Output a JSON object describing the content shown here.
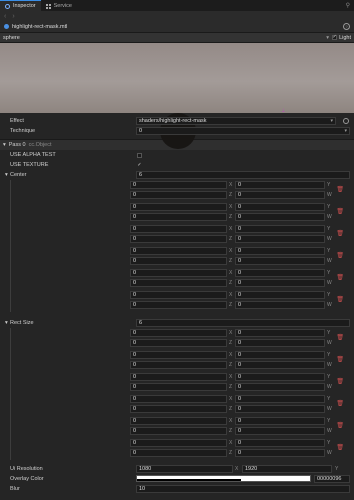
{
  "tabs": [
    {
      "label": "Inspector",
      "icon": "inspector-icon",
      "active": true
    },
    {
      "label": "Service",
      "icon": "grid-icon",
      "active": false
    }
  ],
  "nav": {
    "back": "‹",
    "forward": "›"
  },
  "file": {
    "name": "highlight-rect-mask.mtl"
  },
  "preview": {
    "mesh": "sphere",
    "light_label": "Light",
    "light_checked": true
  },
  "effect": {
    "label": "Effect",
    "value": "shaders/highlight-rect-mask"
  },
  "technique": {
    "label": "Technique",
    "value": "0"
  },
  "pass": {
    "title": "Pass 0",
    "tag": "cc.Object"
  },
  "use_alpha_test": {
    "label": "USE ALPHA TEST",
    "checked": false
  },
  "use_texture": {
    "label": "USE TEXTURE",
    "checked": true
  },
  "center": {
    "label": "Center",
    "count": "6",
    "items": [
      {
        "x": "0",
        "y": "0",
        "z": "0",
        "w": "0"
      },
      {
        "x": "0",
        "y": "0",
        "z": "0",
        "w": "0"
      },
      {
        "x": "0",
        "y": "0",
        "z": "0",
        "w": "0"
      },
      {
        "x": "0",
        "y": "0",
        "z": "0",
        "w": "0"
      },
      {
        "x": "0",
        "y": "0",
        "z": "0",
        "w": "0"
      },
      {
        "x": "0",
        "y": "0",
        "z": "0",
        "w": "0"
      }
    ]
  },
  "rect_size": {
    "label": "Rect Size",
    "count": "6",
    "items": [
      {
        "x": "0",
        "y": "0",
        "z": "0",
        "w": "0"
      },
      {
        "x": "0",
        "y": "0",
        "z": "0",
        "w": "0"
      },
      {
        "x": "0",
        "y": "0",
        "z": "0",
        "w": "0"
      },
      {
        "x": "0",
        "y": "0",
        "z": "0",
        "w": "0"
      },
      {
        "x": "0",
        "y": "0",
        "z": "0",
        "w": "0"
      },
      {
        "x": "0",
        "y": "0",
        "z": "0",
        "w": "0"
      }
    ]
  },
  "ui_resolution": {
    "label": "Ui Resolution",
    "x": "1080",
    "y": "1920"
  },
  "overlay_color": {
    "label": "Overlay Color",
    "hex": "00000096",
    "color": "#000000",
    "alpha": "0.59"
  },
  "blur": {
    "label": "Blur",
    "value": "10"
  },
  "axis_labels": {
    "x": "X",
    "y": "Y",
    "z": "Z",
    "w": "W"
  },
  "colors": {
    "accent": "#3a8ee6",
    "trash": "#d05050"
  }
}
